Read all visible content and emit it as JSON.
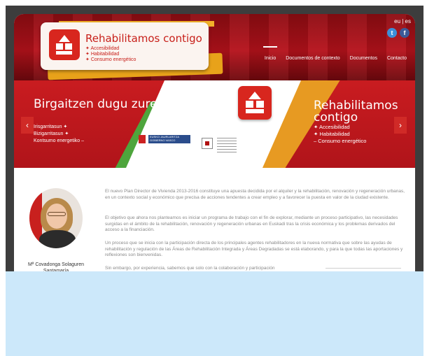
{
  "header": {
    "logo_title": "Rehabilitamos contigo",
    "logo_items": [
      "Accesibilidad",
      "Habitabilidad",
      "Consumo energético"
    ],
    "lang": "eu | es",
    "social": {
      "twitter": "t",
      "facebook": "f"
    },
    "nav": [
      "Inicio",
      "Documentos de contexto",
      "Documentos",
      "Contacto"
    ]
  },
  "slider": {
    "left_title": "Birgaitzen dugu zurekin",
    "left_items": [
      "Irisgarritasun ✦",
      "Bizigarritasun ✦",
      "Kontsumo energetiko –"
    ],
    "right_title": "Rehabilitamos contigo",
    "right_items": [
      "✦ Accesibilidad",
      "✦ Habitabilidad",
      "– Consumo energético"
    ],
    "prev_arrow": "‹",
    "next_arrow": "›",
    "gov_logo_text": "EUSKO JAURLARITZA GOBIERNO VASCO"
  },
  "content": {
    "caption": "Mª Covadonga Solaguren Santamaría",
    "paragraphs": [
      "El nuevo Plan Director de Vivienda 2013-2016 constituye una apuesta decidida por el alquiler y la rehabilitación, renovación y regeneración urbanas, en un contexto social y económico que precisa de acciones tendentes a crear empleo y a favorecer la puesta en valor de la ciudad existente.",
      "El objetivo que ahora nos planteamos es iniciar un programa de trabajo con el fin de explorar, mediante un proceso participativo, las necesidades surgidas en el ámbito de la rehabilitación, renovación y regeneración urbanas en Euskadi tras la crisis económica y los problemas derivados del acceso a la financiación.",
      "Un proceso que se inicia con la participación directa de los principales agentes rehabilitadores en la nueva normativa que sobre las ayudas de rehabilitación y regulación de las Áreas de Rehabilitación Integrada y Áreas Degradadas se está elaborando, y para la que todas las aportaciones y reflexiones son bienvenidas.",
      "Sin embargo, por experiencia, sabemos que solo con la colaboración y participación"
    ]
  }
}
